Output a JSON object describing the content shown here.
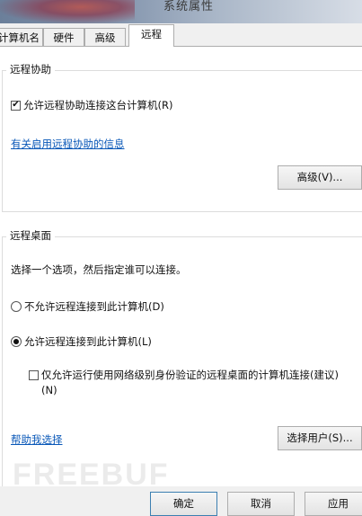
{
  "window": {
    "title": "系统属性"
  },
  "tabs": [
    {
      "label": "计算机名"
    },
    {
      "label": "硬件"
    },
    {
      "label": "高级"
    },
    {
      "label": "远程",
      "active": true
    }
  ],
  "remote_assistance": {
    "group_title": "远程协助",
    "allow_checkbox": {
      "label": "允许远程协助连接这台计算机(R)",
      "checked": true
    },
    "info_link": "有关启用远程协助的信息",
    "advanced_button": "高级(V)..."
  },
  "remote_desktop": {
    "group_title": "远程桌面",
    "instruction": "选择一个选项，然后指定谁可以连接。",
    "option_deny": {
      "label": "不允许远程连接到此计算机(D)",
      "selected": false
    },
    "option_allow": {
      "label": "允许远程连接到此计算机(L)",
      "selected": true
    },
    "nla_checkbox": {
      "label_line1": "仅允许运行使用网络级别身份验证的远程桌面的计算机连接(建议)",
      "label_line2": "(N)",
      "checked": false
    },
    "help_link": "帮助我选择",
    "select_users_button": "选择用户(S)..."
  },
  "footer": {
    "ok": "确定",
    "cancel": "取消",
    "apply": "应用"
  },
  "watermark": "FREEBUF"
}
